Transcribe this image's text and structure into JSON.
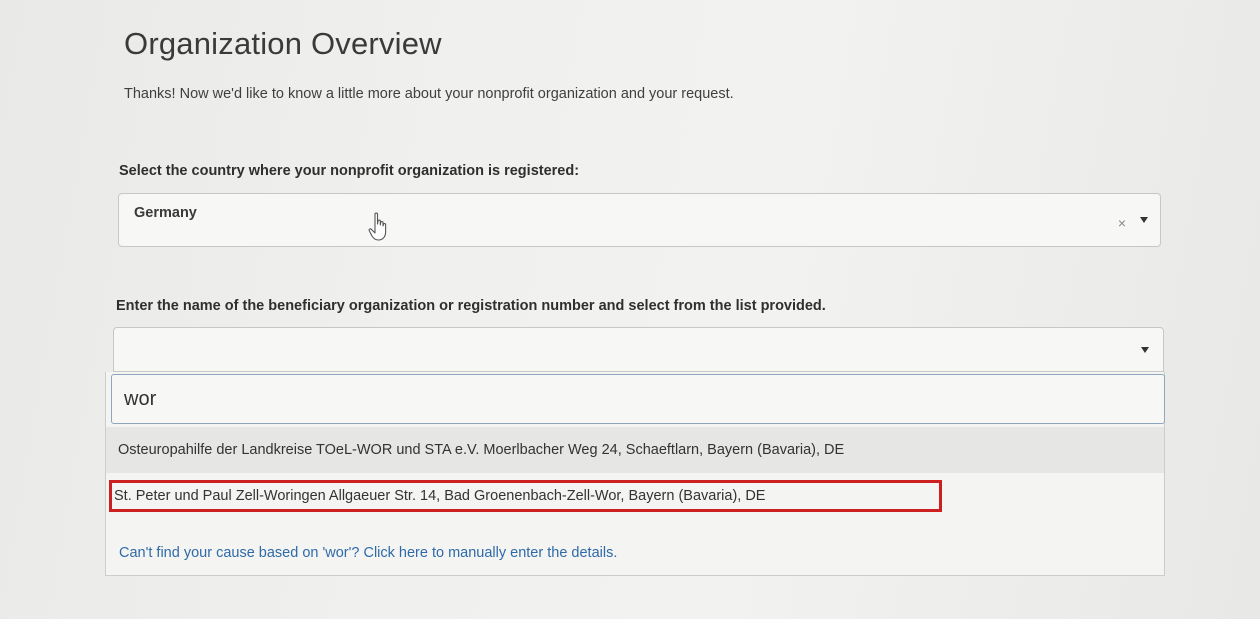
{
  "page": {
    "title": "Organization Overview",
    "subtitle": "Thanks! Now we'd like to know a little more about your nonprofit organization and your request."
  },
  "country_field": {
    "label": "Select the country where your nonprofit organization is registered:",
    "value": "Germany",
    "clear_icon": "×",
    "icons": [
      "clear-icon",
      "chevron-down-icon",
      "hand-pointer-icon"
    ]
  },
  "organization_field": {
    "label": "Enter the name of the beneficiary organization or registration number and select from the list provided.",
    "search_value": "wor",
    "options": [
      {
        "label": "Osteuropahilfe der Landkreise TOeL-WOR und STA e.V. Moerlbacher Weg 24, Schaeftlarn, Bayern (Bavaria), DE"
      },
      {
        "label": "St. Peter und Paul Zell-Woringen Allgaeuer Str. 14, Bad Groenenbach-Zell-Wor, Bayern (Bavaria), DE"
      }
    ],
    "manual_entry_link": "Can't find your cause based on 'wor'? Click here to manually enter the details."
  },
  "colors": {
    "link": "#2f6aa8",
    "highlight_border": "#cc1f1f",
    "search_border": "#8ea6bf"
  }
}
